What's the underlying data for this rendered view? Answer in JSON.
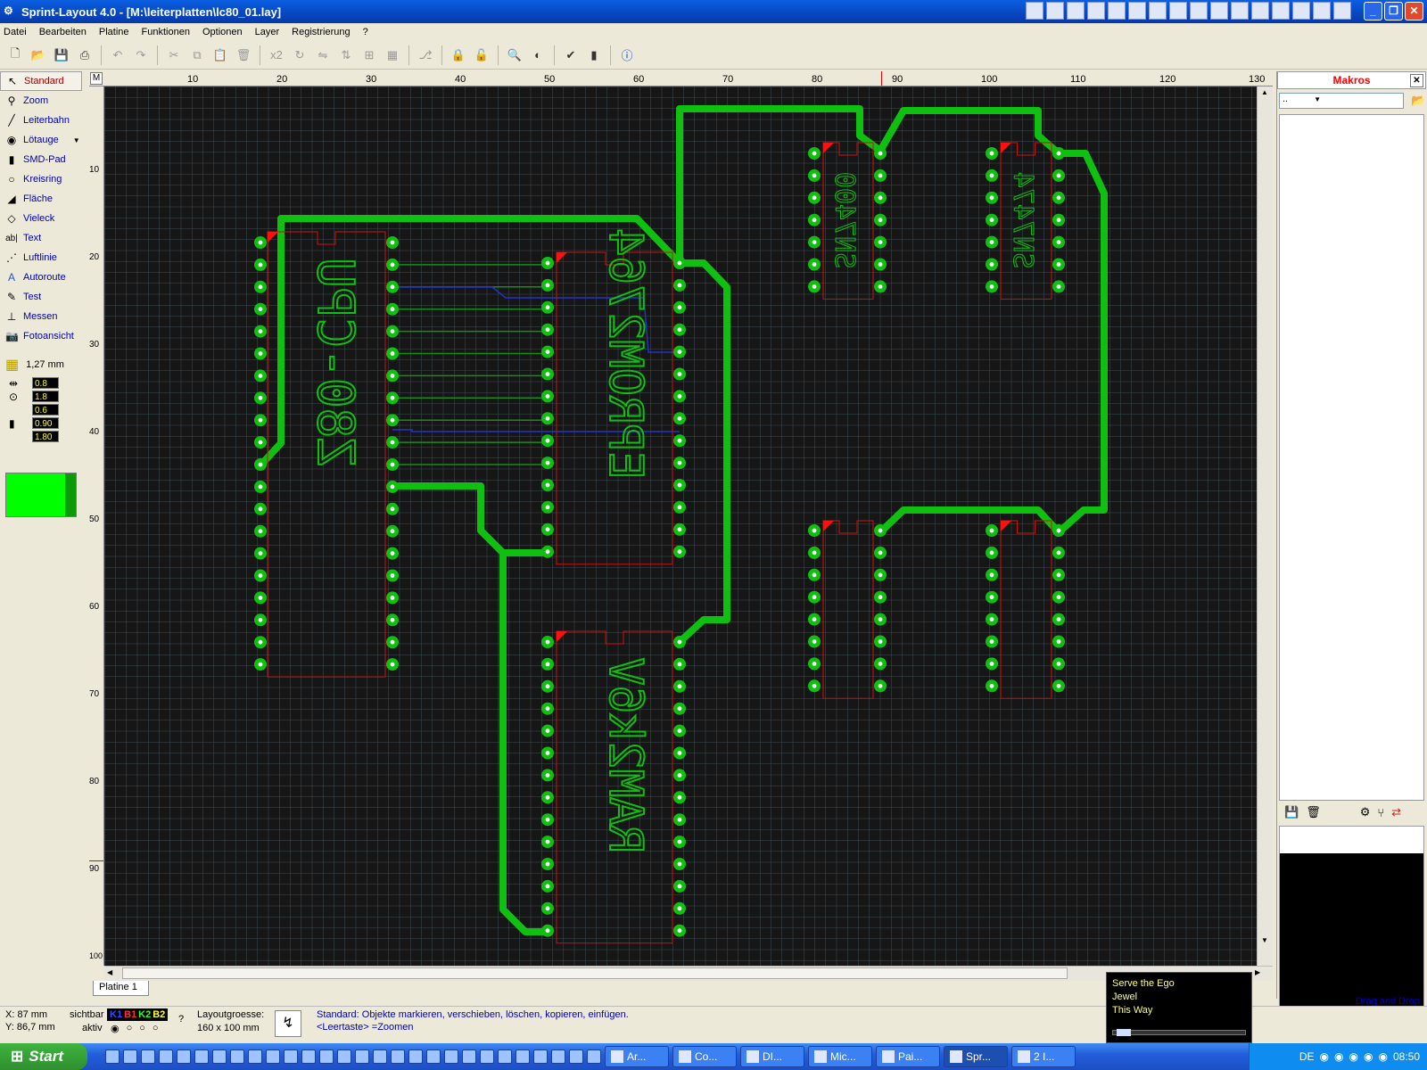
{
  "window": {
    "title": "Sprint-Layout 4.0 - [M:\\leiterplatten\\lc80_01.lay]"
  },
  "menu": [
    "Datei",
    "Bearbeiten",
    "Platine",
    "Funktionen",
    "Optionen",
    "Layer",
    "Registrierung",
    "?"
  ],
  "toolbar": {
    "x2_label": "x2",
    "icons": [
      "new-icon",
      "open-icon",
      "save-icon",
      "print-icon",
      "undo-icon",
      "redo-icon",
      "cut-icon",
      "copy-icon",
      "paste-icon",
      "delete-icon",
      "x2",
      "rotate-icon",
      "mirror-h-icon",
      "mirror-v-icon",
      "align-icon",
      "group-icon",
      "connect-icon",
      "lock-icon",
      "unlock-icon",
      "zoom-icon",
      "brightness-icon",
      "drc-icon",
      "macro-icon",
      "info-icon"
    ]
  },
  "tools": [
    {
      "label": "Standard",
      "icon": "cursor-icon",
      "active": true
    },
    {
      "label": "Zoom",
      "icon": "magnifier-icon"
    },
    {
      "label": "Leiterbahn",
      "icon": "track-icon"
    },
    {
      "label": "Lötauge",
      "icon": "pad-icon"
    },
    {
      "label": "SMD-Pad",
      "icon": "smd-pad-icon"
    },
    {
      "label": "Kreisring",
      "icon": "circle-icon"
    },
    {
      "label": "Fläche",
      "icon": "area-icon"
    },
    {
      "label": "Vieleck",
      "icon": "polygon-icon"
    },
    {
      "label": "Text",
      "icon": "text-icon"
    },
    {
      "label": "Luftlinie",
      "icon": "airwire-icon"
    },
    {
      "label": "Autoroute",
      "icon": "autoroute-icon"
    },
    {
      "label": "Test",
      "icon": "test-icon"
    },
    {
      "label": "Messen",
      "icon": "measure-icon"
    },
    {
      "label": "Fotoansicht",
      "icon": "camera-icon"
    }
  ],
  "grid": {
    "value": "1,27 mm"
  },
  "params": {
    "track_width": "0.8",
    "pad_outer": "1.8",
    "pad_inner": "0.6",
    "smd_w": "0.90",
    "smd_h": "1.80"
  },
  "ruler": {
    "corner": "M",
    "top_ticks": [
      "10",
      "20",
      "30",
      "40",
      "50",
      "60",
      "70",
      "80",
      "90",
      "100",
      "110",
      "120",
      "130"
    ],
    "left_ticks": [
      "10",
      "20",
      "30",
      "40",
      "50",
      "60",
      "70",
      "80",
      "90",
      "100"
    ]
  },
  "board": {
    "labels": [
      "Z80-CPU",
      "EPROM2764",
      "RAM2k6V",
      "SN7400",
      "SN7474"
    ],
    "colors": {
      "background": "#161616",
      "grid": "#3d4d55",
      "track": "#10c010",
      "outline": "#cc1111",
      "pad": "#10c010",
      "thin_track": "#1a8a1a",
      "blue_track": "#2233cc"
    }
  },
  "tab": {
    "label": "Platine 1"
  },
  "macros": {
    "title": "Makros",
    "dropdown": "..",
    "drag_drop": "Drag and Drop"
  },
  "status": {
    "x": "X: 87 mm",
    "y": "Y: 86,7 mm",
    "sichtbar": "sichtbar",
    "aktiv": "aktiv",
    "layers": [
      "K1",
      "B1",
      "K2",
      "B2"
    ],
    "layout_size_label": "Layoutgroesse:",
    "layout_size": "160 x 100 mm",
    "hint1": "Standard: Objekte markieren, verschieben, löschen, kopieren, einfügen.",
    "hint2": "<Leertaste> =Zoomen",
    "help": "?"
  },
  "music": {
    "tracks": [
      "Serve the Ego",
      "Jewel",
      "This Way"
    ]
  },
  "taskbar": {
    "start": "Start",
    "buttons": [
      "Ar...",
      "Co...",
      "DI...",
      "Mic...",
      "Pai...",
      "Spr...",
      "2 I..."
    ],
    "lang": "DE",
    "clock": "08:50"
  }
}
